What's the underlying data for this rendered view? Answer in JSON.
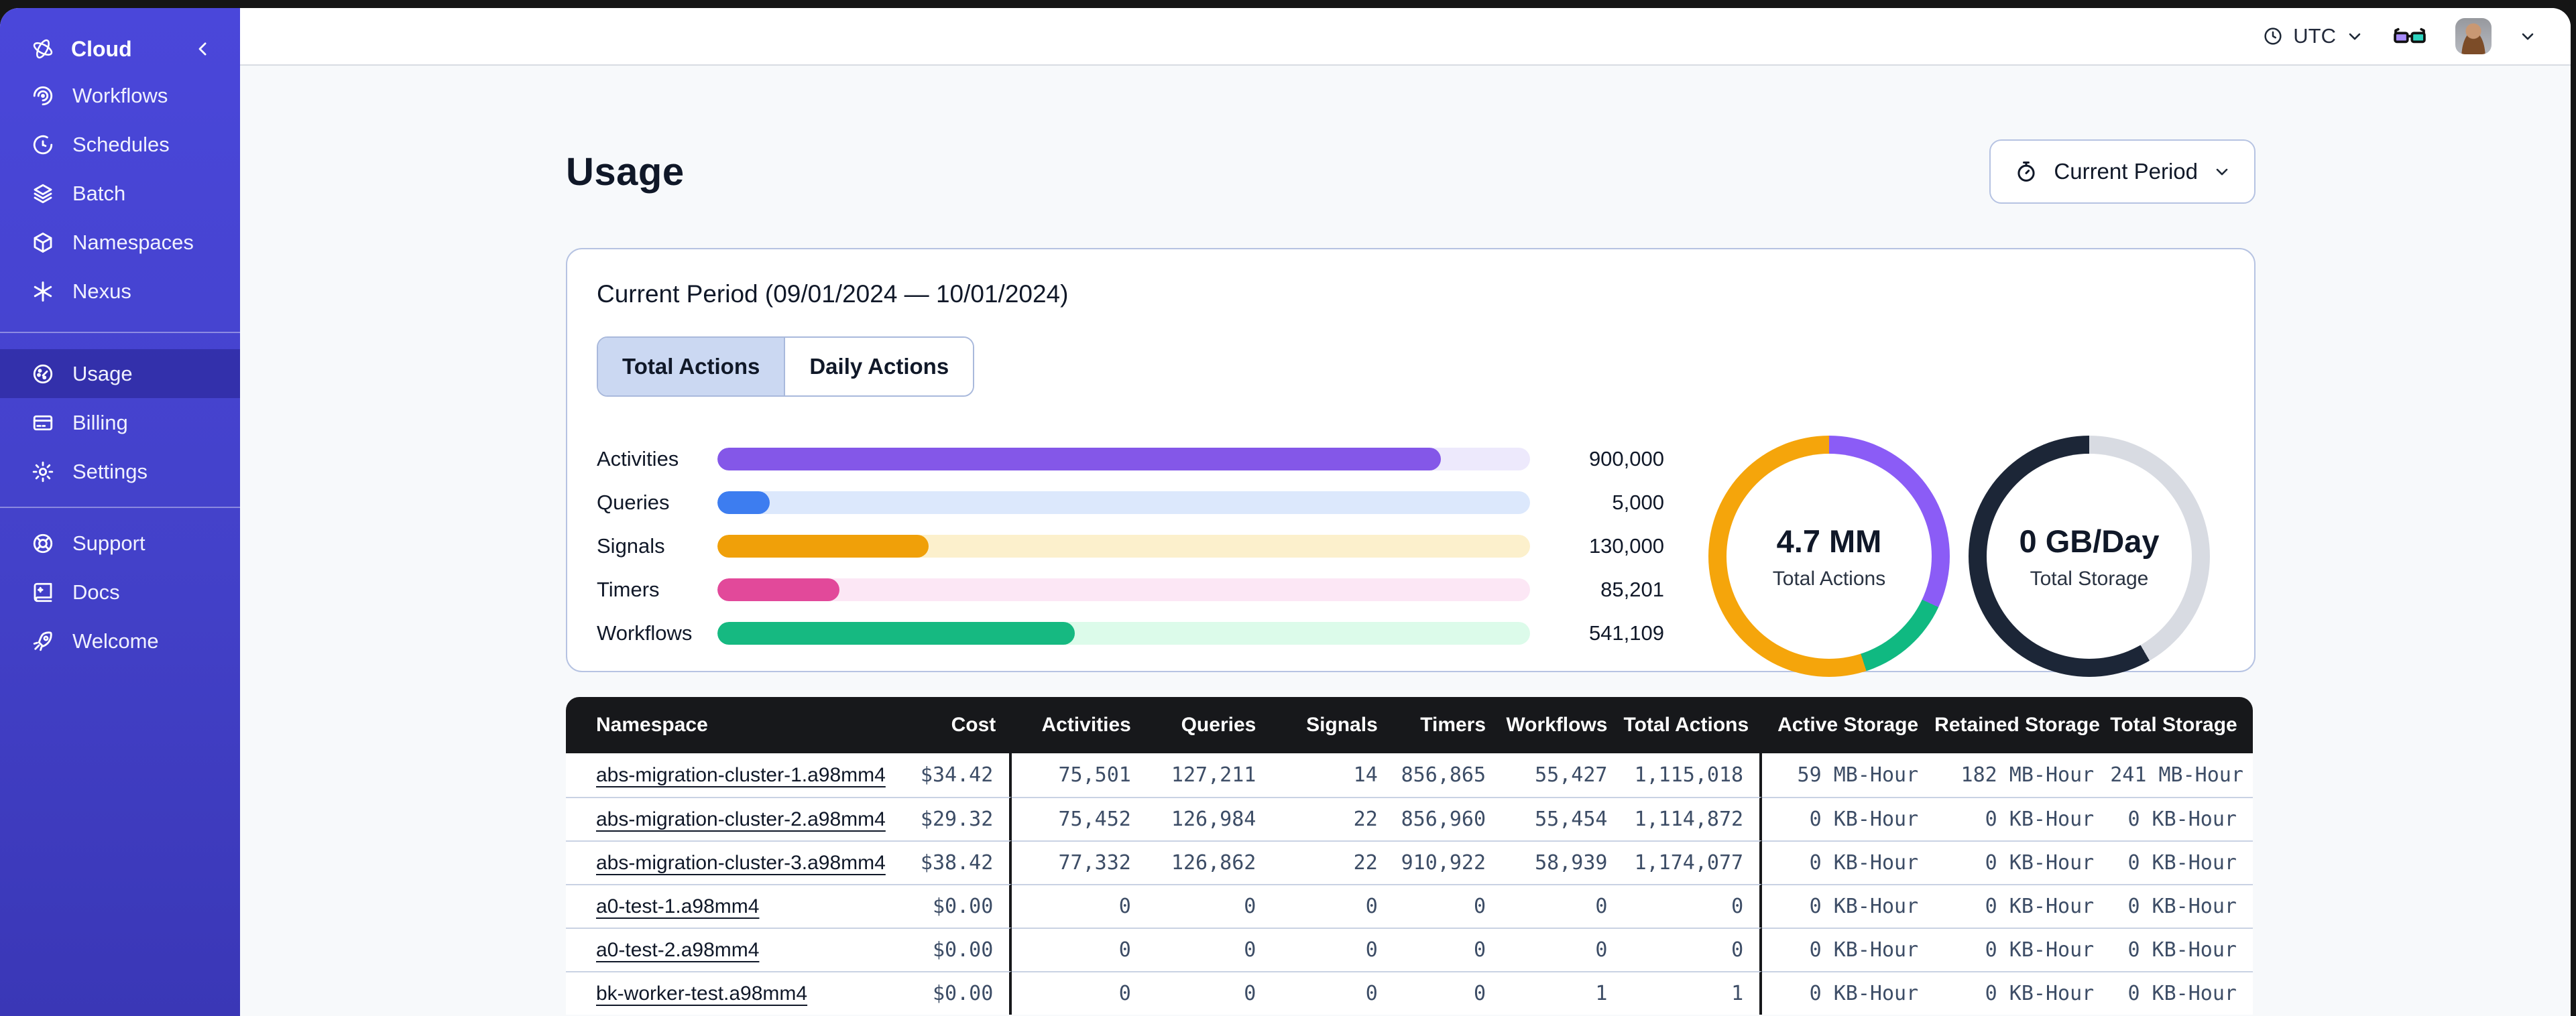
{
  "sidebar": {
    "logo": {
      "label": "Cloud",
      "icon": "temporal-logo-icon",
      "collapse_icon": "chevron-left-icon"
    },
    "main_items": [
      {
        "label": "Workflows",
        "icon": "workflows-icon"
      },
      {
        "label": "Schedules",
        "icon": "schedules-icon"
      },
      {
        "label": "Batch",
        "icon": "batch-icon"
      },
      {
        "label": "Namespaces",
        "icon": "namespaces-icon"
      },
      {
        "label": "Nexus",
        "icon": "nexus-icon"
      }
    ],
    "account_items": [
      {
        "label": "Usage",
        "icon": "usage-icon",
        "active": true
      },
      {
        "label": "Billing",
        "icon": "billing-icon"
      },
      {
        "label": "Settings",
        "icon": "settings-icon"
      }
    ],
    "footer_items": [
      {
        "label": "Support",
        "icon": "support-icon"
      },
      {
        "label": "Docs",
        "icon": "docs-icon"
      },
      {
        "label": "Welcome",
        "icon": "welcome-icon"
      }
    ]
  },
  "topbar": {
    "timezone": {
      "label": "UTC",
      "icon": "clock-icon",
      "chevron": "chevron-down-icon"
    },
    "glasses_icon": "glasses-icon",
    "avatar": "user-avatar",
    "avatar_chevron": "chevron-down-icon"
  },
  "page": {
    "title": "Usage",
    "period_button": {
      "label": "Current Period",
      "icon": "stopwatch-icon",
      "chevron": "chevron-down-icon"
    }
  },
  "card": {
    "title": "Current Period (09/01/2024 — 10/01/2024)",
    "tabs": [
      {
        "label": "Total Actions",
        "active": true
      },
      {
        "label": "Daily Actions",
        "active": false
      }
    ]
  },
  "chart_data": [
    {
      "type": "bar",
      "title": "Total Actions by type",
      "categories": [
        "Activities",
        "Queries",
        "Signals",
        "Timers",
        "Workflows"
      ],
      "values": [
        900000,
        5000,
        130000,
        85201,
        541109
      ],
      "value_labels": [
        "900,000",
        "5,000",
        "130,000",
        "85,201",
        "541,109"
      ],
      "fill_pct": [
        "89%",
        "6.4%",
        "26%",
        "15%",
        "44%"
      ],
      "bar_colors": [
        "#8457E8",
        "#3D7DF0",
        "#F0A009",
        "#E2499A",
        "#16B981"
      ],
      "track_colors": [
        "#EDE9FC",
        "#DCE8FC",
        "#FCF0CC",
        "#FCE7F5",
        "#DCFBEA"
      ],
      "xlabel": "",
      "ylabel": "",
      "grid": false,
      "legend": "none"
    },
    {
      "type": "pie",
      "title": "Total Actions donut",
      "center_value": "4.7 MM",
      "center_label": "Total Actions",
      "segments": [
        {
          "color": "#8B5CF6",
          "from_deg": 0,
          "to_deg": 115
        },
        {
          "color": "#10B981",
          "from_deg": 115,
          "to_deg": 162
        },
        {
          "color": "#F5A50B",
          "from_deg": 162,
          "to_deg": 360
        }
      ],
      "gradient": "conic-gradient(#8B5CF6 0deg 115deg, #10B981 115deg 162deg, #F5A50B 162deg 360deg)"
    },
    {
      "type": "pie",
      "title": "Total Storage donut",
      "center_value": "0 GB/Day",
      "center_label": "Total Storage",
      "segments": [
        {
          "color": "#D8DBE2",
          "from_deg": 0,
          "to_deg": 150
        },
        {
          "color": "#1C2637",
          "from_deg": 150,
          "to_deg": 360
        }
      ],
      "gradient": "conic-gradient(#D8DBE2 0deg 150deg, #1C2637 150deg 360deg)"
    }
  ],
  "table": {
    "columns": [
      "Namespace",
      "Cost",
      "Activities",
      "Queries",
      "Signals",
      "Timers",
      "Workflows",
      "Total Actions",
      "Active Storage",
      "Retained Storage",
      "Total Storage"
    ],
    "rows": [
      [
        "abs-migration-cluster-1.a98mm4",
        "$34.42",
        "75,501",
        "127,211",
        "14",
        "856,865",
        "55,427",
        "1,115,018",
        "59 MB-Hour",
        "182 MB-Hour",
        "241 MB-Hour"
      ],
      [
        "abs-migration-cluster-2.a98mm4",
        "$29.32",
        "75,452",
        "126,984",
        "22",
        "856,960",
        "55,454",
        "1,114,872",
        "0 KB-Hour",
        "0 KB-Hour",
        "0 KB-Hour"
      ],
      [
        "abs-migration-cluster-3.a98mm4",
        "$38.42",
        "77,332",
        "126,862",
        "22",
        "910,922",
        "58,939",
        "1,174,077",
        "0 KB-Hour",
        "0 KB-Hour",
        "0 KB-Hour"
      ],
      [
        "a0-test-1.a98mm4",
        "$0.00",
        "0",
        "0",
        "0",
        "0",
        "0",
        "0",
        "0 KB-Hour",
        "0 KB-Hour",
        "0 KB-Hour"
      ],
      [
        "a0-test-2.a98mm4",
        "$0.00",
        "0",
        "0",
        "0",
        "0",
        "0",
        "0",
        "0 KB-Hour",
        "0 KB-Hour",
        "0 KB-Hour"
      ],
      [
        "bk-worker-test.a98mm4",
        "$0.00",
        "0",
        "0",
        "0",
        "0",
        "1",
        "1",
        "0 KB-Hour",
        "0 KB-Hour",
        "0 KB-Hour"
      ]
    ]
  },
  "colors": {
    "sidebar_top": "#4A47DA",
    "sidebar_bottom": "#3A37B6",
    "table_header_bg": "#17181B",
    "card_border": "#B6C3E2",
    "tab_active_bg": "#CBD8F2",
    "content_bg": "#F7F9FB"
  }
}
